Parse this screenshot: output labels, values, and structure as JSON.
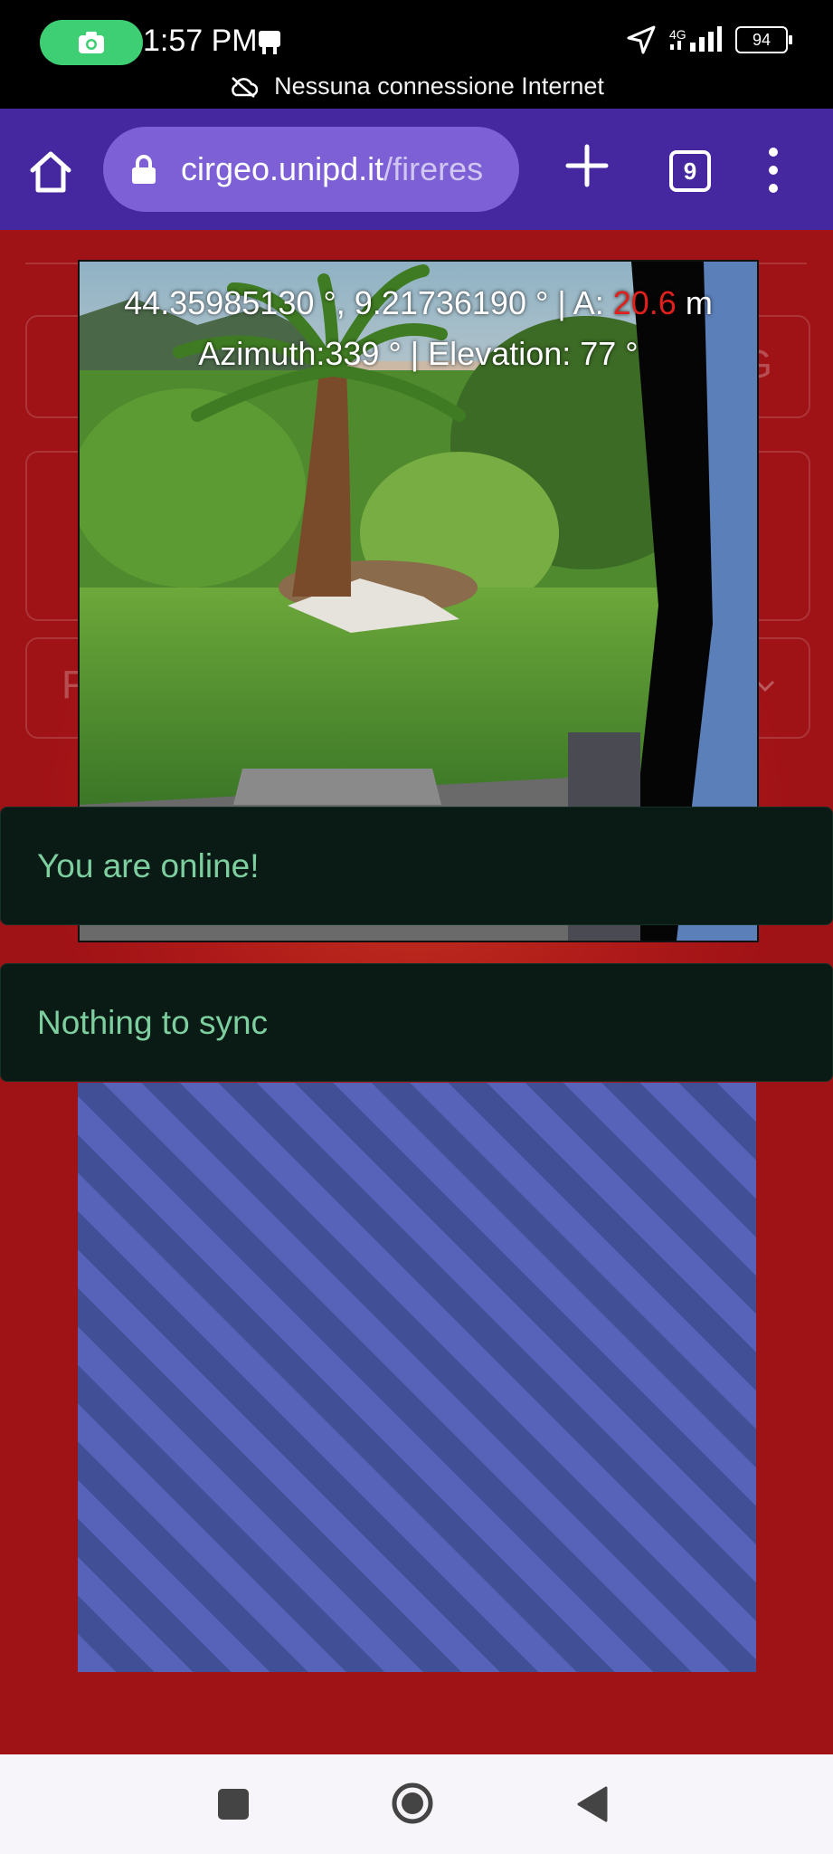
{
  "status_bar": {
    "time": "1:57 PM",
    "network": "4G",
    "battery": "94",
    "offline_banner": "Nessuna connessione Internet"
  },
  "browser": {
    "url_host": "cirgeo.unipd.it",
    "url_path": "/fireres",
    "tab_count": "9"
  },
  "photo": {
    "coords_text": "44.35985130 °, 9.21736190 ° |  A: ",
    "altitude_value": "20.6",
    "altitude_unit": " m",
    "orientation_text": "Azimuth:339 ° |  Elevation: 77 °"
  },
  "background_form": {
    "field_letter": "F",
    "field_letter_right": "G"
  },
  "toasts": [
    {
      "message": "You are online!"
    },
    {
      "message": "Nothing to sync"
    }
  ],
  "colors": {
    "page_bg": "#9f1216",
    "browser_bar": "#4527a0",
    "url_box": "#7d5fd6",
    "toast_bg": "#0a1a14",
    "toast_text": "#7ecf9f",
    "stripe_light": "#5763b8",
    "stripe_dark": "#414f96",
    "camera_pill": "#3ecf74"
  }
}
